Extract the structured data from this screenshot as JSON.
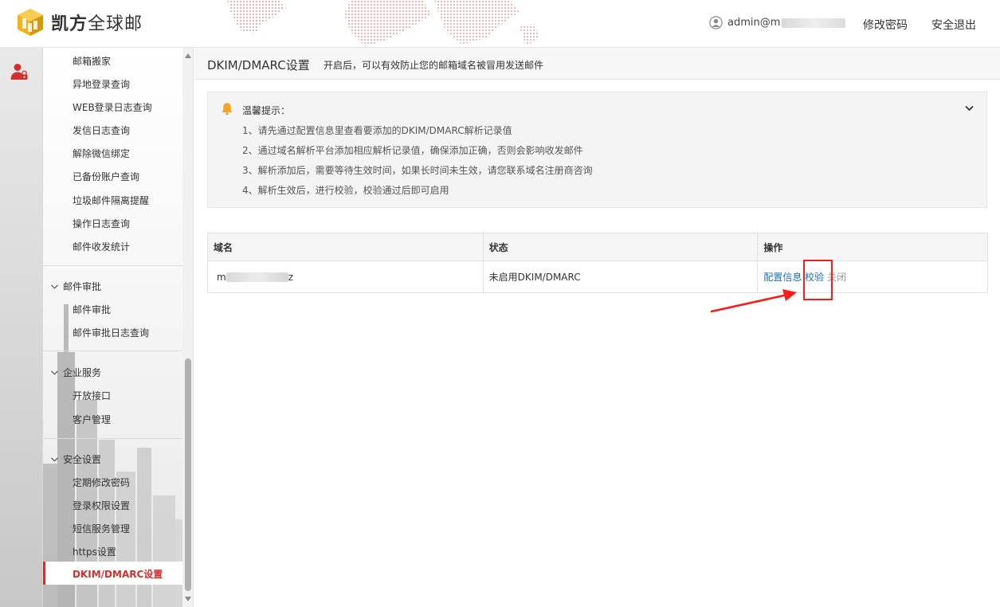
{
  "header": {
    "brand_bold": "凯方",
    "brand_rest": "全球邮",
    "user_prefix": "admin@m",
    "change_password": "修改密码",
    "logout": "安全退出"
  },
  "sidebar": {
    "items_top": [
      "邮箱搬家",
      "异地登录查询",
      "WEB登录日志查询",
      "发信日志查询",
      "解除微信绑定",
      "已备份账户查询",
      "垃圾邮件隔离提醒",
      "操作日志查询",
      "邮件收发统计"
    ],
    "groups": [
      {
        "label": "邮件审批",
        "items": [
          "邮件审批",
          "邮件审批日志查询"
        ]
      },
      {
        "label": "企业服务",
        "items": [
          "开放接口",
          "客户管理"
        ]
      },
      {
        "label": "安全设置",
        "items": [
          "定期修改密码",
          "登录权限设置",
          "短信服务管理",
          "https设置",
          "DKIM/DMARC设置"
        ]
      }
    ],
    "active": "DKIM/DMARC设置"
  },
  "page": {
    "title": "DKIM/DMARC设置",
    "subtitle": "开启后，可以有效防止您的邮箱域名被冒用发送邮件"
  },
  "tips": {
    "title": "温馨提示：",
    "items": [
      "1、请先通过配置信息里查看要添加的DKIM/DMARC解析记录值",
      "2、通过域名解析平台添加相应解析记录值，确保添加正确，否则会影响收发邮件",
      "3、解析添加后，需要等待生效时间，如果长时间未生效，请您联系域名注册商咨询",
      "4、解析生效后，进行校验，校验通过后即可启用"
    ]
  },
  "table": {
    "headers": [
      "域名",
      "状态",
      "操作"
    ],
    "rows": [
      {
        "domain_start": "m",
        "domain_end": "z",
        "status": "未启用DKIM/DMARC",
        "ops": [
          "配置信息",
          "校验",
          "关闭"
        ]
      }
    ]
  },
  "colors": {
    "accent_red": "#d32f2f",
    "link_blue": "#1a6fb5",
    "annotation_red": "#ff1a1a"
  }
}
